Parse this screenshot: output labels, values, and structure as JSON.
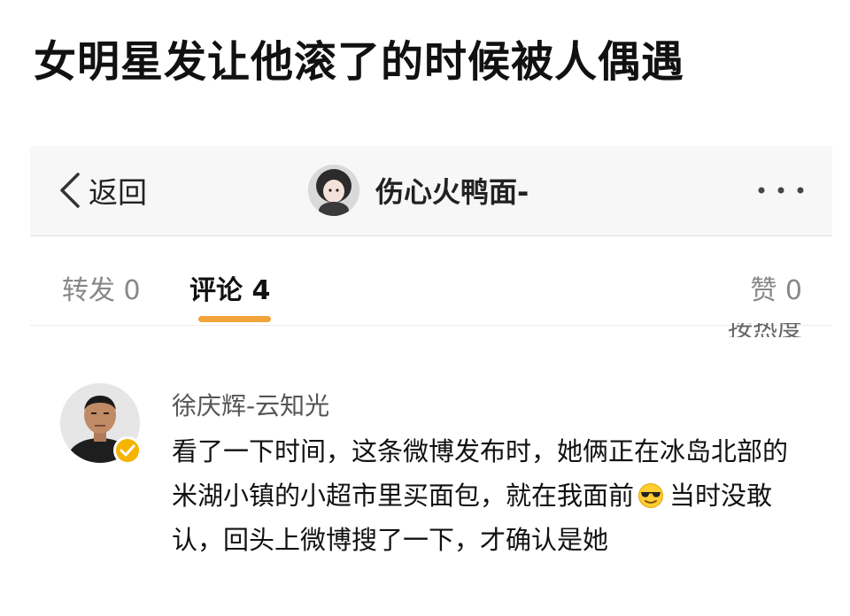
{
  "headline": "女明星发让他滚了的时候被人偶遇",
  "nav": {
    "back_label": "返回",
    "username": "伤心火鸭面-",
    "more_icon": "more-horizontal-icon"
  },
  "tabs": [
    {
      "label": "转发 0"
    },
    {
      "label": "评论 4"
    },
    {
      "label": "赞 0"
    }
  ],
  "sort_label_clipped": "按热度",
  "comment": {
    "author": "徐庆辉-云知光",
    "verified_icon": "verified-badge-icon",
    "text_before_emoji": "看了一下时间，这条微博发布时，她俩正在冰岛北部的米湖小镇的小超市里买面包，就在我面前",
    "emoji_icon": "sunglasses-emoji-icon",
    "text_after_emoji": "当时没敢认，回头上微博搜了一下，才确认是她"
  },
  "colors": {
    "tab_underline": "#f2a33a",
    "verified_badge": "#f5b400",
    "nav_background": "#f7f7f7"
  }
}
